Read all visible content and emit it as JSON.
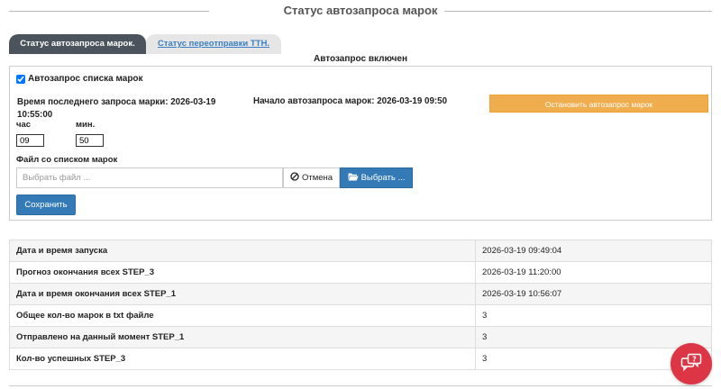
{
  "header": {
    "title": "Статус автозапроса марок"
  },
  "tabs": [
    {
      "label": "Статус автозапроса марок."
    },
    {
      "label": "Статус переотправки ТТН."
    }
  ],
  "status_text": "Автозапрос включен",
  "form": {
    "checkbox_label": "Автозапрос списка марок",
    "checkbox_checked": true,
    "last_request": "Время последнего запроса марки: 2026-03-19 10:55:00",
    "start": "Начало автозапроса марок: 2026-03-19 09:50",
    "stop_button": "Остановить автозапрос марок",
    "hour_label": "час",
    "hour_value": "09",
    "min_label": "мин.",
    "min_value": "50",
    "file_label": "Файл со списком марок",
    "file_placeholder": "Выбрать файл ...",
    "cancel_label": "Отмена",
    "choose_label": "Выбрать ...",
    "save_label": "Сохранить"
  },
  "table": {
    "rows": [
      {
        "key": "Дата и время запуска",
        "value": "2026-03-19 09:49:04"
      },
      {
        "key": "Прогноз окончания всех STEP_3",
        "value": "2026-03-19 11:20:00"
      },
      {
        "key": "Дата и время окончания всех STEP_1",
        "value": "2026-03-19 10:56:07"
      },
      {
        "key": "Общее кол-во марок в txt файле",
        "value": "3"
      },
      {
        "key": "Отправлено на данный момент STEP_1",
        "value": "3"
      },
      {
        "key": "Кол-во успешных STEP_3",
        "value": "3"
      }
    ]
  },
  "colors": {
    "stop_button": "#f0ad4e",
    "primary_button": "#337ab7",
    "active_tab": "#4b545c",
    "help_button": "#dc3545"
  },
  "icons": {
    "cancel": "ban-icon",
    "choose": "folder-open-icon",
    "help": "chat-question-icon"
  }
}
